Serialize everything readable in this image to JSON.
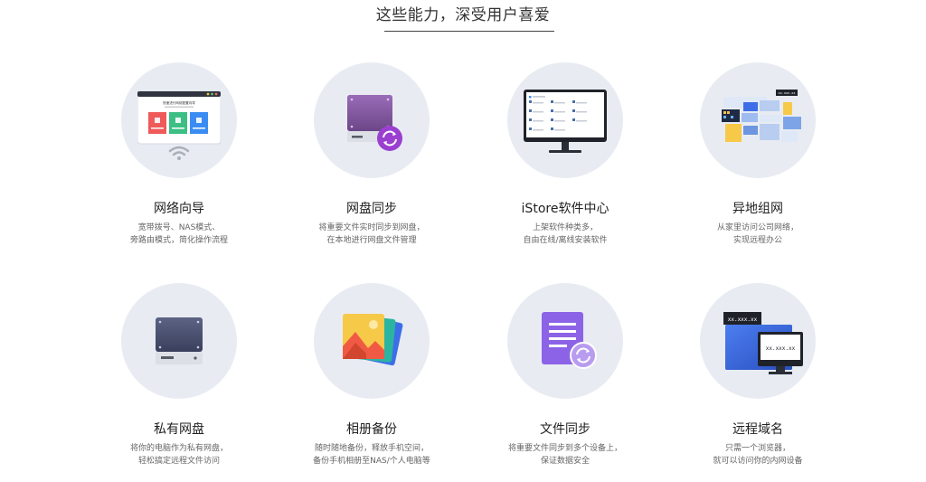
{
  "section": {
    "title": "这些能力，深受用户喜爱"
  },
  "features": [
    {
      "name": "网络向导",
      "desc1": "宽带拨号、NAS模式、",
      "desc2": "旁路由模式，简化操作流程",
      "icon": "network-wizard-icon"
    },
    {
      "name": "网盘同步",
      "desc1": "将重要文件实时同步到网盘，",
      "desc2": "在本地进行网盘文件管理",
      "icon": "cloud-sync-icon"
    },
    {
      "name": "iStore软件中心",
      "desc1": "上架软件种类多，",
      "desc2": "自由在线/离线安装软件",
      "icon": "software-center-icon"
    },
    {
      "name": "异地组网",
      "desc1": "从家里访问公司网络，",
      "desc2": "实现远程办公",
      "icon": "remote-network-icon"
    },
    {
      "name": "私有网盘",
      "desc1": "将你的电脑作为私有网盘，",
      "desc2": "轻松搞定远程文件访问",
      "icon": "private-drive-icon"
    },
    {
      "name": "相册备份",
      "desc1": "随时随地备份，释放手机空间，",
      "desc2": "备份手机相册至NAS/个人电脑等",
      "icon": "photo-backup-icon"
    },
    {
      "name": "文件同步",
      "desc1": "将重要文件同步到多个设备上，",
      "desc2": "保证数据安全",
      "icon": "file-sync-icon"
    },
    {
      "name": "远程域名",
      "desc1": "只需一个浏览器，",
      "desc2": "就可以访问你的内网设备",
      "icon": "remote-domain-icon"
    }
  ],
  "illustration_text": {
    "wizard_heading": "快速进行网络配置向导",
    "ip_mask": "xx.xxx.xx"
  },
  "colors": {
    "circle_bg": "#e8ecf2",
    "purple": "#8e4fc6",
    "blue": "#3d6ee8",
    "yellow": "#f7c948"
  }
}
